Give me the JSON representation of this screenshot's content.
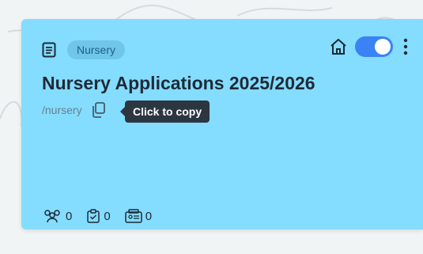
{
  "card": {
    "badge": "Nursery",
    "title": "Nursery Applications 2025/2026",
    "path": "/nursery",
    "tooltip": "Click to copy",
    "toggle_on": true,
    "stats": {
      "participants": "0",
      "tasks": "0",
      "groups": "0"
    }
  },
  "colors": {
    "card_bg": "#84dcff",
    "accent": "#3b82f6",
    "badge_bg": "#6fc6ea",
    "tooltip_bg": "#2b3641"
  },
  "icons": {
    "doc": "document-icon",
    "home": "home-icon",
    "menu": "more-vertical-icon",
    "copy": "copy-icon",
    "participants": "users-icon",
    "tasks": "clipboard-check-icon",
    "groups": "id-cards-icon"
  }
}
